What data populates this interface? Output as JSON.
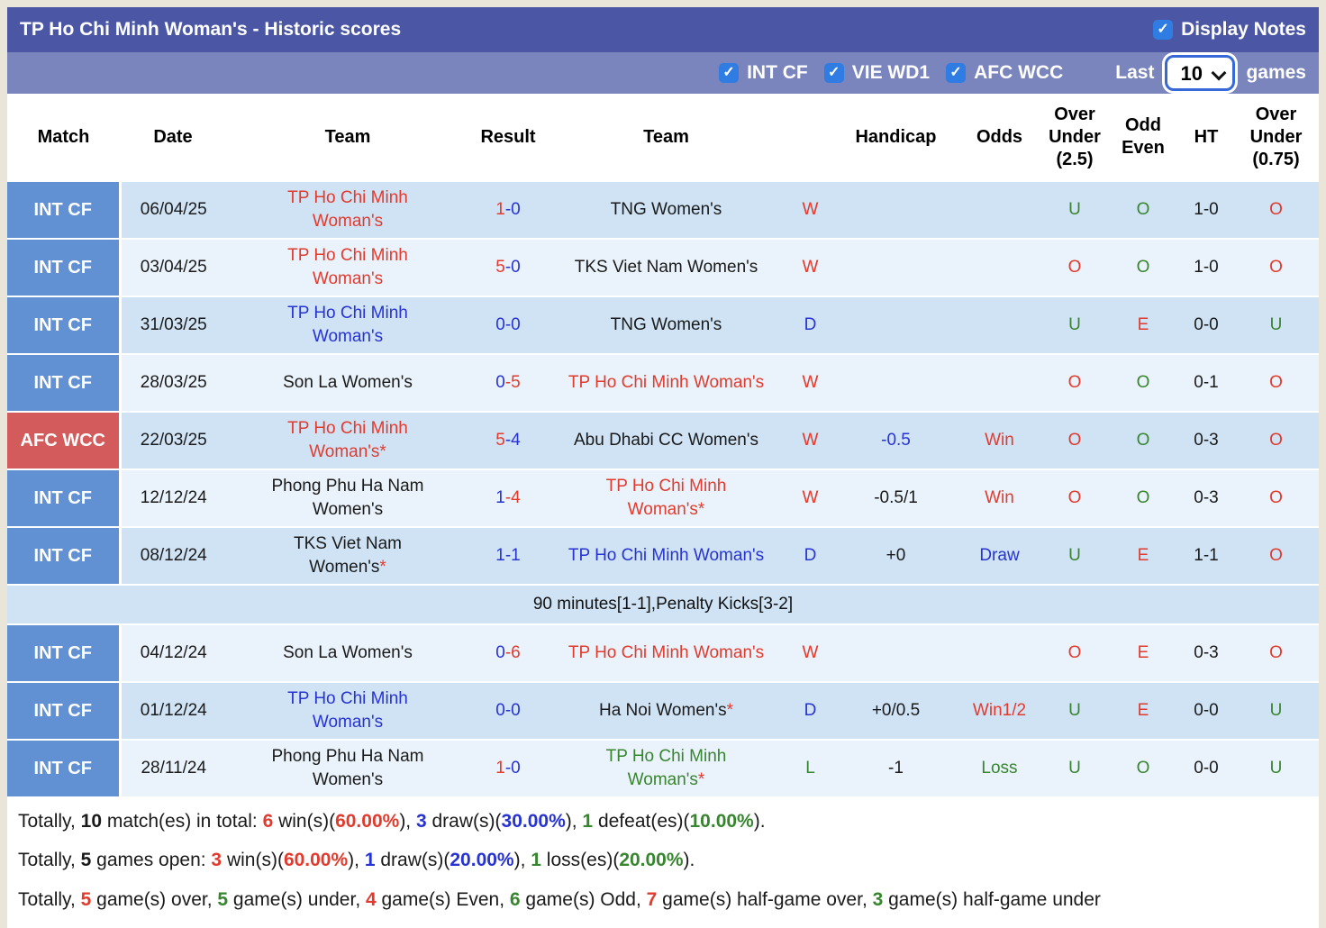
{
  "header": {
    "title": "TP Ho Chi Minh Woman's - Historic scores",
    "display_notes_label": "Display Notes"
  },
  "controls": {
    "filters": [
      {
        "label": "INT CF",
        "checked": true
      },
      {
        "label": "VIE WD1",
        "checked": true
      },
      {
        "label": "AFC WCC",
        "checked": true
      }
    ],
    "last_label": "Last",
    "games_count": "10",
    "games_label": "games"
  },
  "colors": {
    "red": "#e23b2e",
    "blue": "#2733d3",
    "green": "#37852f",
    "black": "#1a1a1a",
    "badge_blue": "#6191d2",
    "badge_red": "#d45b5b"
  },
  "table": {
    "headers": [
      {
        "label": "Match"
      },
      {
        "label": "Date"
      },
      {
        "label": "Team"
      },
      {
        "label": "Result"
      },
      {
        "label": "Team"
      },
      {
        "label": ""
      },
      {
        "label": "Handicap"
      },
      {
        "label": "Odds"
      },
      {
        "label": "Over\nUnder\n(2.5)"
      },
      {
        "label": "Odd\nEven"
      },
      {
        "label": "HT"
      },
      {
        "label": "Over\nUnder\n(0.75)"
      }
    ],
    "rows": [
      {
        "comp": "INT CF",
        "comp_bg": "badge_blue",
        "date": "06/04/25",
        "home": {
          "text": "TP Ho Chi Minh Woman's",
          "color": "red",
          "suffix": ""
        },
        "result": [
          {
            "text": "1",
            "color": "red"
          },
          {
            "text": "-0",
            "color": "blue"
          }
        ],
        "away": {
          "text": "TNG Women's",
          "color": "black",
          "suffix": ""
        },
        "outcome": {
          "text": "W",
          "color": "red"
        },
        "handicap": {
          "text": "",
          "color": "black"
        },
        "odds": {
          "text": "",
          "color": "red"
        },
        "ou25": {
          "text": "U",
          "color": "green"
        },
        "odd_even": {
          "text": "O",
          "color": "green"
        },
        "ht": "1-0",
        "ou075": {
          "text": "O",
          "color": "red"
        },
        "shade": "dark",
        "note": ""
      },
      {
        "comp": "INT CF",
        "comp_bg": "badge_blue",
        "date": "03/04/25",
        "home": {
          "text": "TP Ho Chi Minh Woman's",
          "color": "red",
          "suffix": ""
        },
        "result": [
          {
            "text": "5",
            "color": "red"
          },
          {
            "text": "-0",
            "color": "blue"
          }
        ],
        "away": {
          "text": "TKS Viet Nam Women's",
          "color": "black",
          "suffix": ""
        },
        "outcome": {
          "text": "W",
          "color": "red"
        },
        "handicap": {
          "text": "",
          "color": "black"
        },
        "odds": {
          "text": "",
          "color": "red"
        },
        "ou25": {
          "text": "O",
          "color": "red"
        },
        "odd_even": {
          "text": "O",
          "color": "green"
        },
        "ht": "1-0",
        "ou075": {
          "text": "O",
          "color": "red"
        },
        "shade": "light",
        "note": ""
      },
      {
        "comp": "INT CF",
        "comp_bg": "badge_blue",
        "date": "31/03/25",
        "home": {
          "text": "TP Ho Chi Minh Woman's",
          "color": "blue",
          "suffix": ""
        },
        "result": [
          {
            "text": "0-0",
            "color": "blue"
          }
        ],
        "away": {
          "text": "TNG Women's",
          "color": "black",
          "suffix": ""
        },
        "outcome": {
          "text": "D",
          "color": "blue"
        },
        "handicap": {
          "text": "",
          "color": "black"
        },
        "odds": {
          "text": "",
          "color": "red"
        },
        "ou25": {
          "text": "U",
          "color": "green"
        },
        "odd_even": {
          "text": "E",
          "color": "red"
        },
        "ht": "0-0",
        "ou075": {
          "text": "U",
          "color": "green"
        },
        "shade": "dark",
        "note": ""
      },
      {
        "comp": "INT CF",
        "comp_bg": "badge_blue",
        "date": "28/03/25",
        "home": {
          "text": "Son La Women's",
          "color": "black",
          "suffix": ""
        },
        "result": [
          {
            "text": "0",
            "color": "blue"
          },
          {
            "text": "-5",
            "color": "red"
          }
        ],
        "away": {
          "text": "TP Ho Chi Minh Woman's",
          "color": "red",
          "suffix": ""
        },
        "outcome": {
          "text": "W",
          "color": "red"
        },
        "handicap": {
          "text": "",
          "color": "black"
        },
        "odds": {
          "text": "",
          "color": "red"
        },
        "ou25": {
          "text": "O",
          "color": "red"
        },
        "odd_even": {
          "text": "O",
          "color": "green"
        },
        "ht": "0-1",
        "ou075": {
          "text": "O",
          "color": "red"
        },
        "shade": "light",
        "note": ""
      },
      {
        "comp": "AFC WCC",
        "comp_bg": "badge_red",
        "date": "22/03/25",
        "home": {
          "text": "TP Ho Chi Minh Woman's",
          "color": "red",
          "suffix": "*"
        },
        "result": [
          {
            "text": "5",
            "color": "red"
          },
          {
            "text": "-4",
            "color": "blue"
          }
        ],
        "away": {
          "text": "Abu Dhabi CC Women's",
          "color": "black",
          "suffix": ""
        },
        "outcome": {
          "text": "W",
          "color": "red"
        },
        "handicap": {
          "text": "-0.5",
          "color": "blue"
        },
        "odds": {
          "text": "Win",
          "color": "red"
        },
        "ou25": {
          "text": "O",
          "color": "red"
        },
        "odd_even": {
          "text": "O",
          "color": "green"
        },
        "ht": "0-3",
        "ou075": {
          "text": "O",
          "color": "red"
        },
        "shade": "dark",
        "note": ""
      },
      {
        "comp": "INT CF",
        "comp_bg": "badge_blue",
        "date": "12/12/24",
        "home": {
          "text": "Phong Phu Ha Nam Women's",
          "color": "black",
          "suffix": ""
        },
        "result": [
          {
            "text": "1",
            "color": "blue"
          },
          {
            "text": "-4",
            "color": "red"
          }
        ],
        "away": {
          "text": "TP Ho Chi Minh Woman's",
          "color": "red",
          "suffix": "*"
        },
        "outcome": {
          "text": "W",
          "color": "red"
        },
        "handicap": {
          "text": "-0.5/1",
          "color": "black"
        },
        "odds": {
          "text": "Win",
          "color": "red"
        },
        "ou25": {
          "text": "O",
          "color": "red"
        },
        "odd_even": {
          "text": "O",
          "color": "green"
        },
        "ht": "0-3",
        "ou075": {
          "text": "O",
          "color": "red"
        },
        "shade": "light",
        "note": ""
      },
      {
        "comp": "INT CF",
        "comp_bg": "badge_blue",
        "date": "08/12/24",
        "home": {
          "text": "TKS Viet Nam Women's",
          "color": "black",
          "suffix": "*"
        },
        "result": [
          {
            "text": "1-1",
            "color": "blue"
          }
        ],
        "away": {
          "text": "TP Ho Chi Minh Woman's",
          "color": "blue",
          "suffix": ""
        },
        "outcome": {
          "text": "D",
          "color": "blue"
        },
        "handicap": {
          "text": "+0",
          "color": "black"
        },
        "odds": {
          "text": "Draw",
          "color": "blue"
        },
        "ou25": {
          "text": "U",
          "color": "green"
        },
        "odd_even": {
          "text": "E",
          "color": "red"
        },
        "ht": "1-1",
        "ou075": {
          "text": "O",
          "color": "red"
        },
        "shade": "dark",
        "note": "90 minutes[1-1],Penalty Kicks[3-2]"
      },
      {
        "comp": "INT CF",
        "comp_bg": "badge_blue",
        "date": "04/12/24",
        "home": {
          "text": "Son La Women's",
          "color": "black",
          "suffix": ""
        },
        "result": [
          {
            "text": "0",
            "color": "blue"
          },
          {
            "text": "-6",
            "color": "red"
          }
        ],
        "away": {
          "text": "TP Ho Chi Minh Woman's",
          "color": "red",
          "suffix": ""
        },
        "outcome": {
          "text": "W",
          "color": "red"
        },
        "handicap": {
          "text": "",
          "color": "black"
        },
        "odds": {
          "text": "",
          "color": "red"
        },
        "ou25": {
          "text": "O",
          "color": "red"
        },
        "odd_even": {
          "text": "E",
          "color": "red"
        },
        "ht": "0-3",
        "ou075": {
          "text": "O",
          "color": "red"
        },
        "shade": "light",
        "note": ""
      },
      {
        "comp": "INT CF",
        "comp_bg": "badge_blue",
        "date": "01/12/24",
        "home": {
          "text": "TP Ho Chi Minh Woman's",
          "color": "blue",
          "suffix": ""
        },
        "result": [
          {
            "text": "0-0",
            "color": "blue"
          }
        ],
        "away": {
          "text": "Ha Noi Women's",
          "color": "black",
          "suffix": "*"
        },
        "outcome": {
          "text": "D",
          "color": "blue"
        },
        "handicap": {
          "text": "+0/0.5",
          "color": "black"
        },
        "odds": {
          "text": "Win1/2",
          "color": "red"
        },
        "ou25": {
          "text": "U",
          "color": "green"
        },
        "odd_even": {
          "text": "E",
          "color": "red"
        },
        "ht": "0-0",
        "ou075": {
          "text": "U",
          "color": "green"
        },
        "shade": "dark",
        "note": ""
      },
      {
        "comp": "INT CF",
        "comp_bg": "badge_blue",
        "date": "28/11/24",
        "home": {
          "text": "Phong Phu Ha Nam Women's",
          "color": "black",
          "suffix": ""
        },
        "result": [
          {
            "text": "1",
            "color": "red"
          },
          {
            "text": "-0",
            "color": "blue"
          }
        ],
        "away": {
          "text": "TP Ho Chi Minh Woman's",
          "color": "green",
          "suffix": "*"
        },
        "outcome": {
          "text": "L",
          "color": "green"
        },
        "handicap": {
          "text": "-1",
          "color": "black"
        },
        "odds": {
          "text": "Loss",
          "color": "green"
        },
        "ou25": {
          "text": "U",
          "color": "green"
        },
        "odd_even": {
          "text": "O",
          "color": "green"
        },
        "ht": "0-0",
        "ou075": {
          "text": "U",
          "color": "green"
        },
        "shade": "light",
        "note": ""
      }
    ]
  },
  "footer": {
    "lines": [
      {
        "segments": [
          {
            "t": "Totally, ",
            "c": "black",
            "b": false
          },
          {
            "t": "10",
            "c": "black",
            "b": true
          },
          {
            "t": " match(es) in total: ",
            "c": "black",
            "b": false
          },
          {
            "t": "6",
            "c": "red",
            "b": true
          },
          {
            "t": " win(s)(",
            "c": "black",
            "b": false
          },
          {
            "t": "60.00%",
            "c": "red",
            "b": true
          },
          {
            "t": "), ",
            "c": "black",
            "b": false
          },
          {
            "t": "3",
            "c": "blue",
            "b": true
          },
          {
            "t": " draw(s)(",
            "c": "black",
            "b": false
          },
          {
            "t": "30.00%",
            "c": "blue",
            "b": true
          },
          {
            "t": "), ",
            "c": "black",
            "b": false
          },
          {
            "t": "1",
            "c": "green",
            "b": true
          },
          {
            "t": " defeat(es)(",
            "c": "black",
            "b": false
          },
          {
            "t": "10.00%",
            "c": "green",
            "b": true
          },
          {
            "t": ").",
            "c": "black",
            "b": false
          }
        ]
      },
      {
        "segments": [
          {
            "t": "Totally, ",
            "c": "black",
            "b": false
          },
          {
            "t": "5",
            "c": "black",
            "b": true
          },
          {
            "t": " games open: ",
            "c": "black",
            "b": false
          },
          {
            "t": "3",
            "c": "red",
            "b": true
          },
          {
            "t": " win(s)(",
            "c": "black",
            "b": false
          },
          {
            "t": "60.00%",
            "c": "red",
            "b": true
          },
          {
            "t": "), ",
            "c": "black",
            "b": false
          },
          {
            "t": "1",
            "c": "blue",
            "b": true
          },
          {
            "t": " draw(s)(",
            "c": "black",
            "b": false
          },
          {
            "t": "20.00%",
            "c": "blue",
            "b": true
          },
          {
            "t": "), ",
            "c": "black",
            "b": false
          },
          {
            "t": "1",
            "c": "green",
            "b": true
          },
          {
            "t": " loss(es)(",
            "c": "black",
            "b": false
          },
          {
            "t": "20.00%",
            "c": "green",
            "b": true
          },
          {
            "t": ").",
            "c": "black",
            "b": false
          }
        ]
      },
      {
        "segments": [
          {
            "t": "Totally, ",
            "c": "black",
            "b": false
          },
          {
            "t": "5",
            "c": "red",
            "b": true
          },
          {
            "t": " game(s) over, ",
            "c": "black",
            "b": false
          },
          {
            "t": "5",
            "c": "green",
            "b": true
          },
          {
            "t": " game(s) under, ",
            "c": "black",
            "b": false
          },
          {
            "t": "4",
            "c": "red",
            "b": true
          },
          {
            "t": " game(s) Even, ",
            "c": "black",
            "b": false
          },
          {
            "t": "6",
            "c": "green",
            "b": true
          },
          {
            "t": " game(s) Odd, ",
            "c": "black",
            "b": false
          },
          {
            "t": "7",
            "c": "red",
            "b": true
          },
          {
            "t": " game(s) half-game over, ",
            "c": "black",
            "b": false
          },
          {
            "t": "3",
            "c": "green",
            "b": true
          },
          {
            "t": " game(s) half-game under",
            "c": "black",
            "b": false
          }
        ]
      }
    ]
  }
}
